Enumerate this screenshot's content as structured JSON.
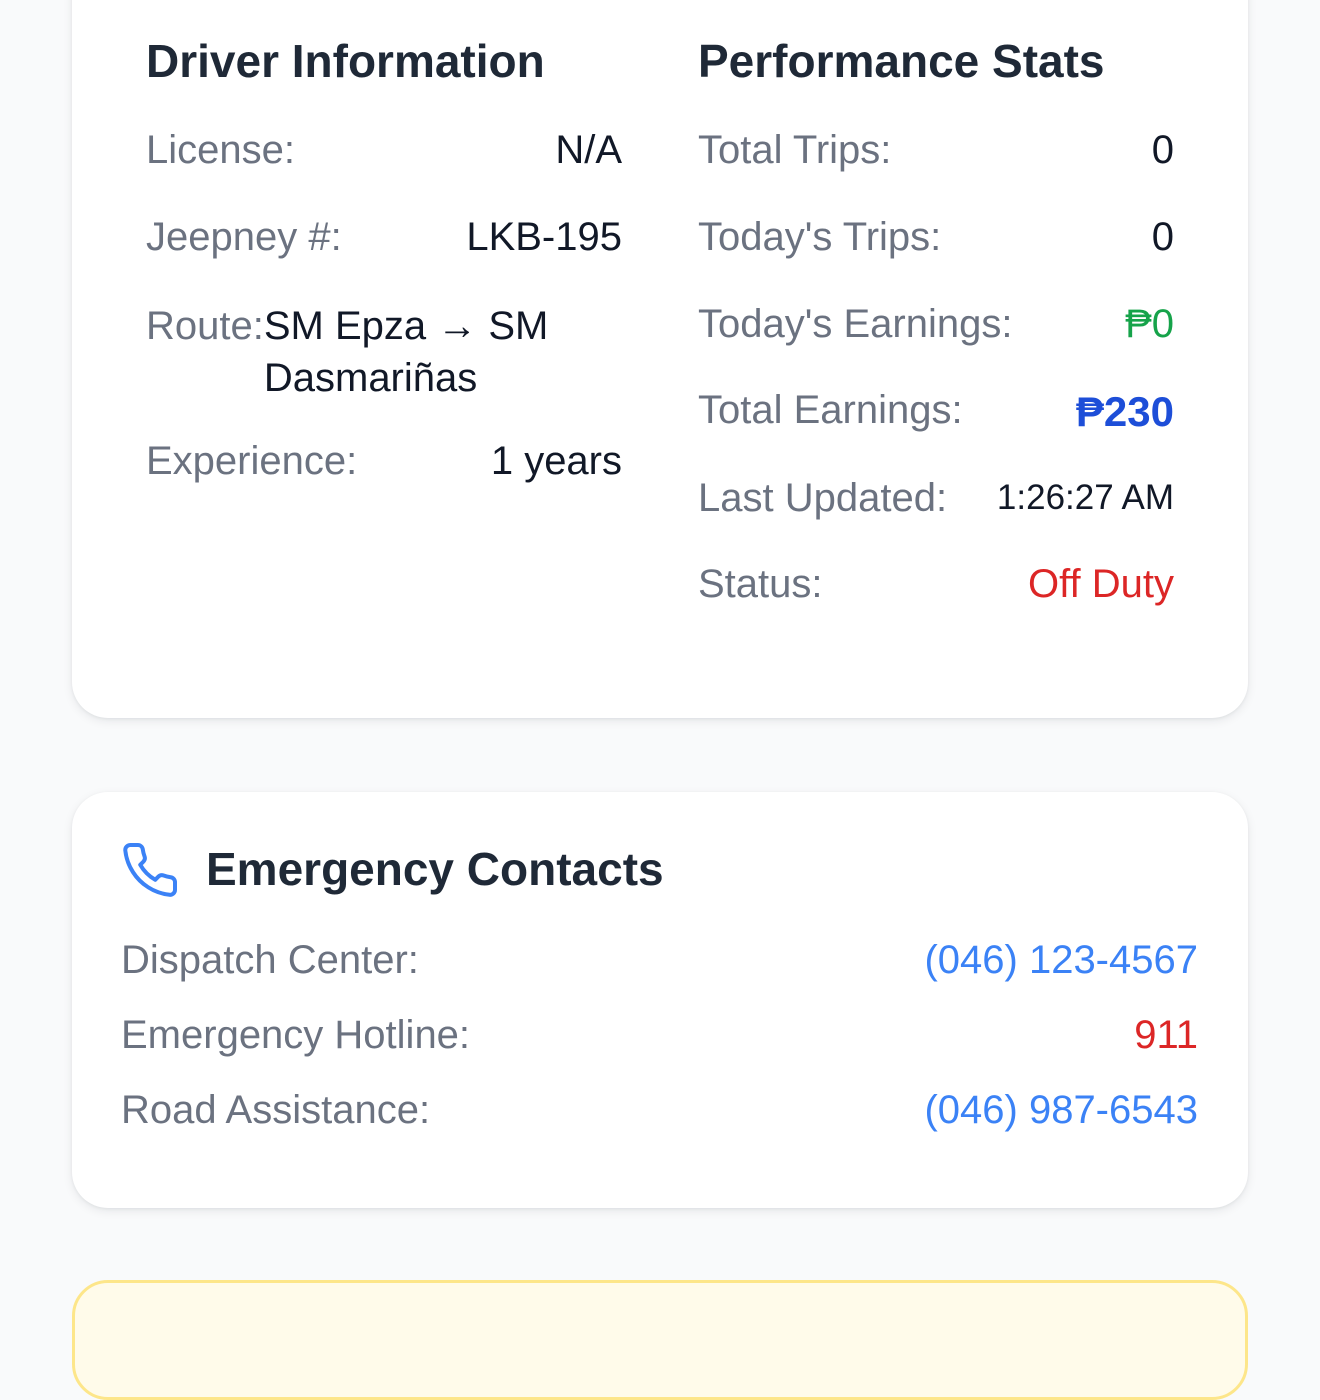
{
  "driver_info": {
    "title": "Driver Information",
    "license_label": "License:",
    "license_value": "N/A",
    "jeepney_label": "Jeepney #:",
    "jeepney_value": "LKB-195",
    "route_label": "Route:",
    "route_value": "SM Epza → SM Dasmariñas",
    "experience_label": "Experience:",
    "experience_value": "1 years"
  },
  "performance": {
    "title": "Performance Stats",
    "total_trips_label": "Total Trips:",
    "total_trips_value": "0",
    "todays_trips_label": "Today's Trips:",
    "todays_trips_value": "0",
    "todays_earnings_label": "Today's Earnings:",
    "todays_earnings_value": "₱0",
    "total_earnings_label": "Total Earnings:",
    "total_earnings_value": "₱230",
    "last_updated_label": "Last Updated:",
    "last_updated_value": "1:26:27 AM",
    "status_label": "Status:",
    "status_value": "Off Duty"
  },
  "emergency": {
    "icon": "phone-icon",
    "title": "Emergency Contacts",
    "contacts": [
      {
        "label": "Dispatch Center:",
        "value": "(046) 123-4567"
      },
      {
        "label": "Emergency Hotline:",
        "value": "911"
      },
      {
        "label": "Road Assistance:",
        "value": "(046) 987-6543"
      }
    ]
  },
  "colors": {
    "green": "#16a34a",
    "blue": "#1d4ed8",
    "link": "#3b82f6",
    "red": "#dc2626",
    "tip_bg": "#fffbea",
    "tip_border": "#fde68a"
  }
}
